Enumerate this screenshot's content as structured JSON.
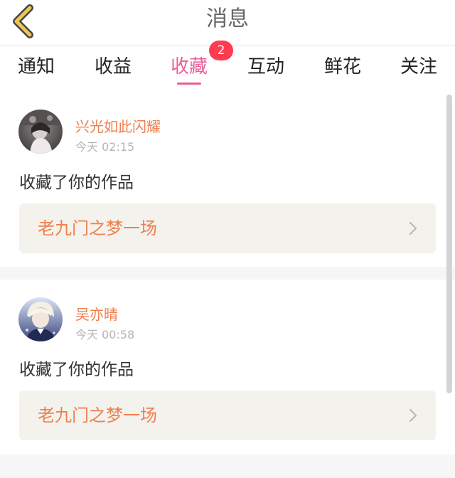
{
  "header": {
    "title": "消息",
    "back_icon": "chevron-left-icon",
    "back_color": "#f1c64d"
  },
  "tabs": [
    {
      "label": "通知",
      "active": false
    },
    {
      "label": "收益",
      "active": false
    },
    {
      "label": "收藏",
      "active": true,
      "badge": "2"
    },
    {
      "label": "互动",
      "active": false
    },
    {
      "label": "鲜花",
      "active": false
    },
    {
      "label": "关注",
      "active": false
    }
  ],
  "colors": {
    "accent": "#ea5f97",
    "badge": "#ff3b50",
    "username": "#f07f4f",
    "work_box": "#f3f2ec"
  },
  "messages": [
    {
      "username": "兴光如此闪耀",
      "time": "今天 02:15",
      "action": "收藏了你的作品",
      "work_title": "老九门之梦一场",
      "chevron_icon": "chevron-right-icon"
    },
    {
      "username": "吴亦晴",
      "time": "今天 00:58",
      "action": "收藏了你的作品",
      "work_title": "老九门之梦一场",
      "chevron_icon": "chevron-right-icon"
    }
  ]
}
